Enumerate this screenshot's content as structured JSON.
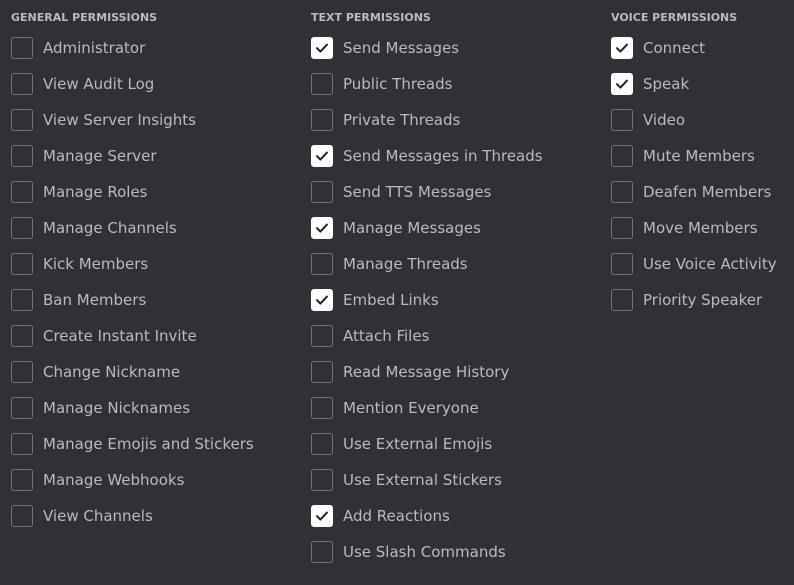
{
  "colors": {
    "background": "#2f3136",
    "text": "#b9bbbe",
    "checkbox_border": "#72767d",
    "checkbox_checked_fill": "#ffffff",
    "check_mark": "#202225"
  },
  "columns": [
    {
      "title": "GENERAL PERMISSIONS",
      "items": [
        {
          "label": "Administrator",
          "checked": false
        },
        {
          "label": "View Audit Log",
          "checked": false
        },
        {
          "label": "View Server Insights",
          "checked": false
        },
        {
          "label": "Manage Server",
          "checked": false
        },
        {
          "label": "Manage Roles",
          "checked": false
        },
        {
          "label": "Manage Channels",
          "checked": false
        },
        {
          "label": "Kick Members",
          "checked": false
        },
        {
          "label": "Ban Members",
          "checked": false
        },
        {
          "label": "Create Instant Invite",
          "checked": false
        },
        {
          "label": "Change Nickname",
          "checked": false
        },
        {
          "label": "Manage Nicknames",
          "checked": false
        },
        {
          "label": "Manage Emojis and Stickers",
          "checked": false
        },
        {
          "label": "Manage Webhooks",
          "checked": false
        },
        {
          "label": "View Channels",
          "checked": false
        }
      ]
    },
    {
      "title": "TEXT PERMISSIONS",
      "items": [
        {
          "label": "Send Messages",
          "checked": true
        },
        {
          "label": "Public Threads",
          "checked": false
        },
        {
          "label": "Private Threads",
          "checked": false
        },
        {
          "label": "Send Messages in Threads",
          "checked": true
        },
        {
          "label": "Send TTS Messages",
          "checked": false
        },
        {
          "label": "Manage Messages",
          "checked": true
        },
        {
          "label": "Manage Threads",
          "checked": false
        },
        {
          "label": "Embed Links",
          "checked": true
        },
        {
          "label": "Attach Files",
          "checked": false
        },
        {
          "label": "Read Message History",
          "checked": false
        },
        {
          "label": "Mention Everyone",
          "checked": false
        },
        {
          "label": "Use External Emojis",
          "checked": false
        },
        {
          "label": "Use External Stickers",
          "checked": false
        },
        {
          "label": "Add Reactions",
          "checked": true
        },
        {
          "label": "Use Slash Commands",
          "checked": false
        }
      ]
    },
    {
      "title": "VOICE PERMISSIONS",
      "items": [
        {
          "label": "Connect",
          "checked": true
        },
        {
          "label": "Speak",
          "checked": true
        },
        {
          "label": "Video",
          "checked": false
        },
        {
          "label": "Mute Members",
          "checked": false
        },
        {
          "label": "Deafen Members",
          "checked": false
        },
        {
          "label": "Move Members",
          "checked": false
        },
        {
          "label": "Use Voice Activity",
          "checked": false
        },
        {
          "label": "Priority Speaker",
          "checked": false
        }
      ]
    }
  ]
}
